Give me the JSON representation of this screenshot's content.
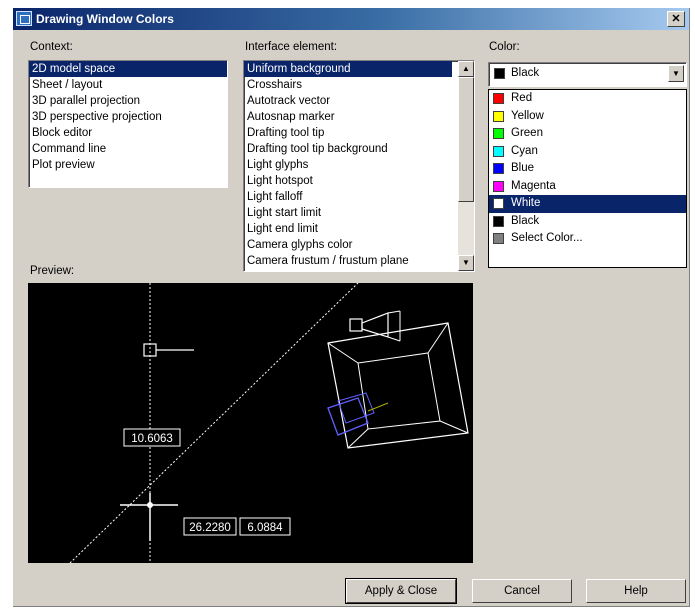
{
  "window": {
    "title": "Drawing Window Colors",
    "close_glyph": "✕"
  },
  "context": {
    "label": "Context:",
    "items": [
      "2D model space",
      "Sheet / layout",
      "3D parallel projection",
      "3D perspective projection",
      "Block editor",
      "Command line",
      "Plot preview"
    ],
    "selected": "2D model space"
  },
  "interface": {
    "label": "Interface element:",
    "items": [
      "Uniform background",
      "Crosshairs",
      "Autotrack vector",
      "Autosnap marker",
      "Drafting tool tip",
      "Drafting tool tip background",
      "Light glyphs",
      "Light hotspot",
      "Light falloff",
      "Light start limit",
      "Light end limit",
      "Camera glyphs color",
      "Camera frustum / frustum plane"
    ],
    "selected": "Uniform background"
  },
  "color": {
    "label": "Color:",
    "current": "Black",
    "current_color": "#000000",
    "options": [
      {
        "label": "Red",
        "color": "#ff0000"
      },
      {
        "label": "Yellow",
        "color": "#ffff00"
      },
      {
        "label": "Green",
        "color": "#00ff00"
      },
      {
        "label": "Cyan",
        "color": "#00ffff"
      },
      {
        "label": "Blue",
        "color": "#0000ff"
      },
      {
        "label": "Magenta",
        "color": "#ff00ff"
      },
      {
        "label": "White",
        "color": "#ffffff"
      },
      {
        "label": "Black",
        "color": "#000000"
      },
      {
        "label": "Select Color...",
        "color": "select-color-icon"
      }
    ],
    "highlighted": "White"
  },
  "preview": {
    "label": "Preview:",
    "dim_vertical": "10.6063",
    "dim_horizontal_1": "26.2280",
    "dim_horizontal_2": "6.0884"
  },
  "buttons": {
    "apply": "Apply & Close",
    "cancel": "Cancel",
    "help": "Help"
  },
  "icons": {
    "scroll_up": "▲",
    "scroll_down": "▼",
    "combo_arrow": "▼"
  }
}
